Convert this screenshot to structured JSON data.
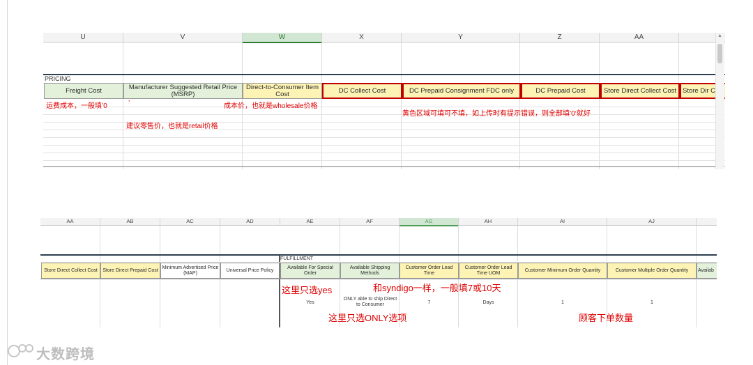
{
  "sheet1": {
    "columns": [
      "U",
      "V",
      "W",
      "X",
      "Y",
      "Z",
      "AA"
    ],
    "selected_column": "W",
    "section_label": "PRICING",
    "headers": [
      "Freight Cost",
      "Manufacturer Suggested Retail Price (MSRP)",
      "Direct-to-Consumer Item Cost",
      "DC Collect Cost",
      "DC Prepaid Consignment FDC only",
      "DC Prepaid Cost",
      "Store Direct Collect Cost",
      "Store Dir C"
    ],
    "annotations": {
      "freight": "运费成本，一般填’0",
      "tick": "’",
      "cost_price": "成本价，也就是wholesale价格",
      "yellow_area": "黄色区域可填可不填，如上传时有提示错误，则全部填’0‘就好",
      "retail": "建议零售价，也就是retail价格"
    }
  },
  "sheet2": {
    "columns": [
      "AA",
      "AB",
      "AC",
      "AD",
      "AE",
      "AF",
      "AG",
      "AH",
      "AI",
      "AJ"
    ],
    "selected_column": "AG",
    "section_label": "FULFILLMENT",
    "headers": [
      "Store Direct Collect Cost",
      "Store Direct Prepaid Cost",
      "Minimum Advertised Price (MAP)",
      "Universal Price Policy",
      "Available For Special Order",
      "Available Shipping Methods",
      "Customer Order Lead Time",
      "Customer Order Lead Time UOM",
      "Customer Minimum Order Quantity",
      "Customer Multiple Order Quantity",
      "Availab"
    ],
    "values": {
      "special_order": "Yes",
      "shipping": "ONLY able to ship Direct to Consumer",
      "lead_time": "7",
      "lead_uom": "Days",
      "min_qty": "1",
      "multiple_qty": "1"
    },
    "annotations": {
      "yes_only": "这里只选yes",
      "syndigo": "和syndigo一样，一般填7或10天",
      "only_option": "这里只选ONLY选项",
      "customer_qty": "顾客下单数量"
    }
  },
  "watermark": {
    "text": "大数跨境"
  },
  "colors": {
    "annotation_red": "#e00000",
    "header_green": "#e3f1da",
    "header_yellow": "#fdf3b5",
    "selected_column": "#d2e6d4",
    "box_red": "#c00000"
  }
}
